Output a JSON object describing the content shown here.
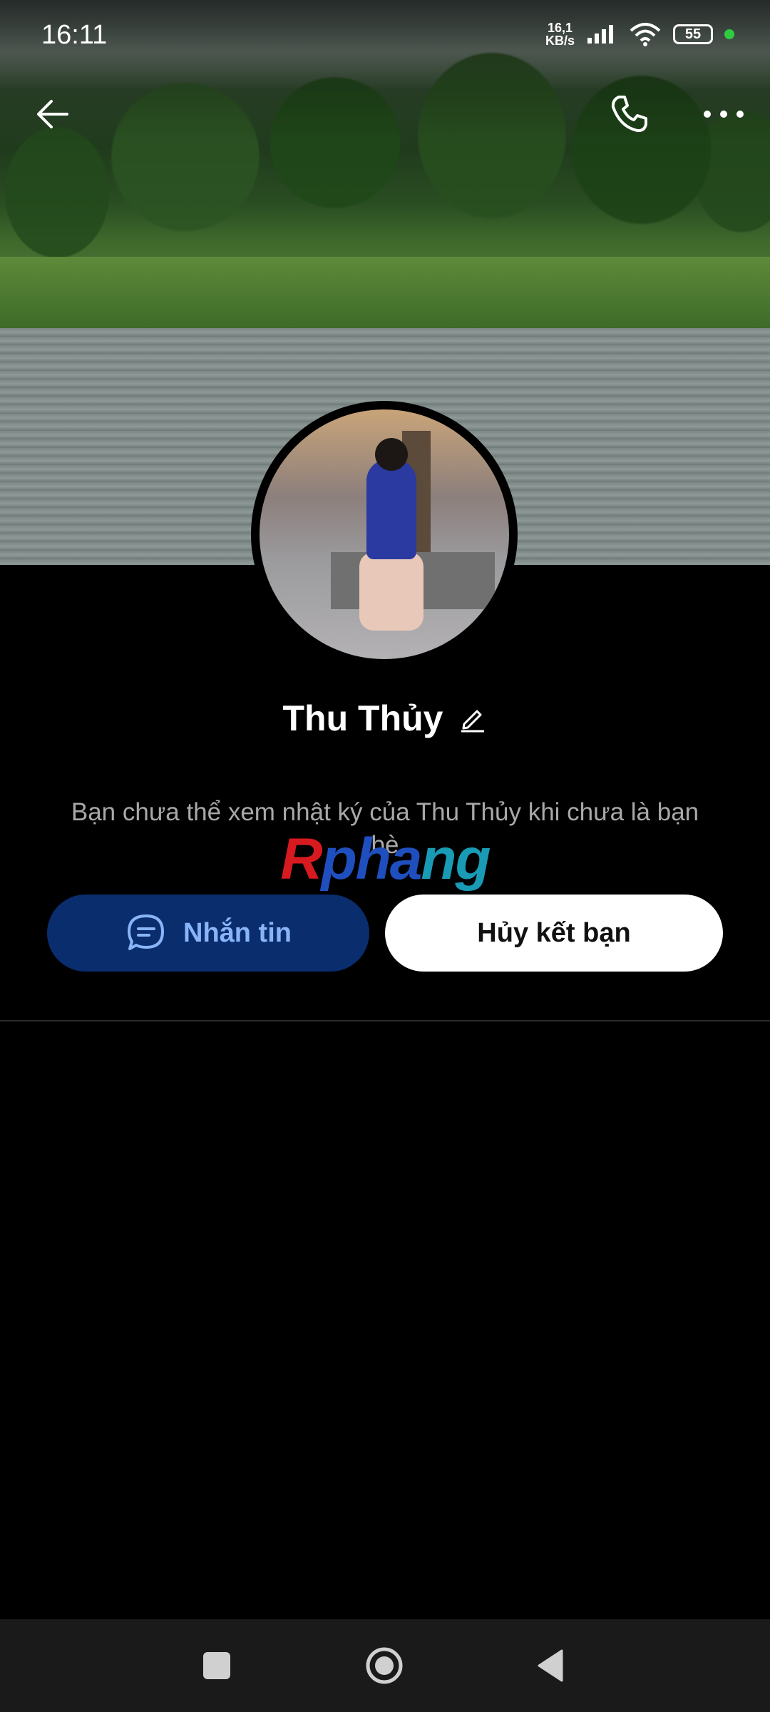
{
  "status_bar": {
    "time": "16:11",
    "net_speed_value": "16,1",
    "net_speed_unit": "KB/s",
    "battery": "55",
    "icons": [
      "signal-icon",
      "wifi-icon",
      "battery-icon",
      "privacy-dot-icon"
    ]
  },
  "top_actions": {
    "icons": [
      "back-arrow-icon",
      "phone-icon",
      "more-icon"
    ]
  },
  "profile": {
    "name": "Thu Thủy",
    "notice": "Bạn chưa thể xem nhật ký của Thu Thủy khi chưa là bạn bè"
  },
  "watermark": {
    "part1": "R",
    "part2": "pha",
    "part3": "ng"
  },
  "actions": {
    "message_label": "Nhắn tin",
    "unfriend_label": "Hủy kết bạn"
  },
  "colors": {
    "message_button_bg": "#0a2d6e",
    "message_button_text": "#8ab4f8",
    "unfriend_button_bg": "#ffffff",
    "background": "#000000"
  }
}
